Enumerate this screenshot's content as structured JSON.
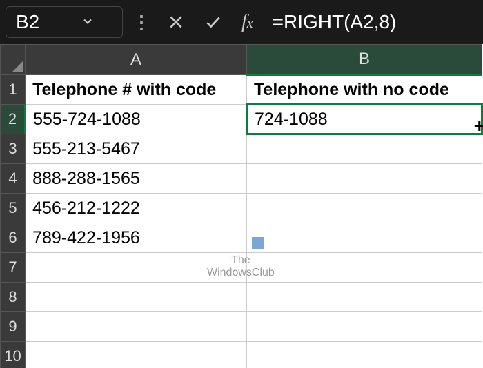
{
  "namebox": {
    "cell_ref": "B2"
  },
  "formula_bar": {
    "formula": "=RIGHT(A2,8)"
  },
  "columns": {
    "a": "A",
    "b": "B"
  },
  "rows": [
    "1",
    "2",
    "3",
    "4",
    "5",
    "6",
    "7",
    "8",
    "9",
    "10"
  ],
  "header_row": {
    "col_a": "Telephone # with code",
    "col_b": "Telephone with no code"
  },
  "data": {
    "a2": "555-724-1088",
    "a3": "555-213-5467",
    "a4": "888-288-1565",
    "a5": "456-212-1222",
    "a6": "789-422-1956",
    "b2": "724-1088"
  },
  "watermark": {
    "line1": "The",
    "line2": "WindowsClub"
  }
}
